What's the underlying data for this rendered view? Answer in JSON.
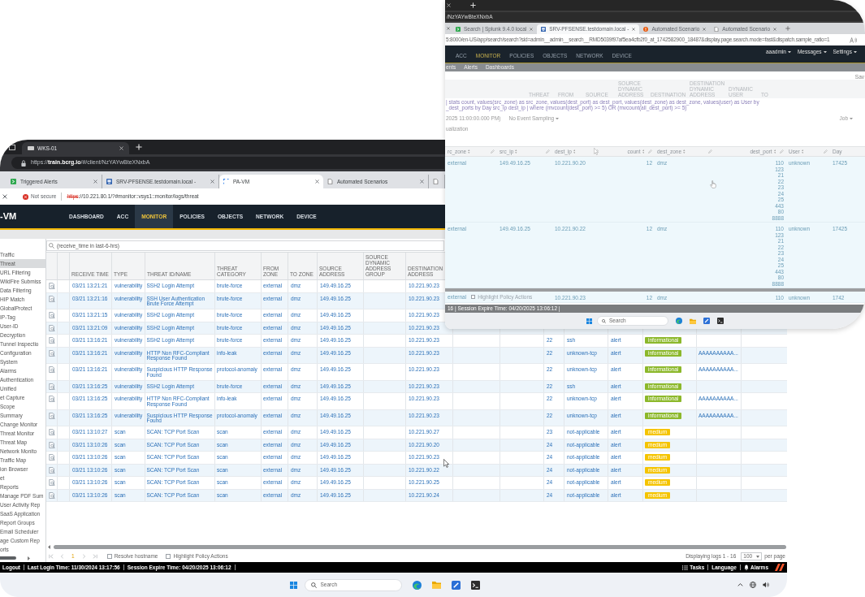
{
  "front_window": {
    "window_tab": {
      "title": "WKS-01"
    },
    "address": "https://**train.bcrg.io**/#/client/NzYAYwBteXNxbA",
    "tabs": [
      {
        "title": "Triggered Alerts",
        "selected": false
      },
      {
        "title": "SRV-PFSENSE.testdomain.local -",
        "selected": false
      },
      {
        "title": "PA-VM",
        "selected": true
      },
      {
        "title": "Automated Scenarios",
        "selected": false
      },
      {
        "selected": false
      }
    ],
    "security": "Not secure",
    "url": {
      "scheme": "https",
      "rest": "://10.221.80.1/?#monitor::vsys1::monitor/logs/threat"
    },
    "logo": "-VM",
    "nav": [
      {
        "label": "DASHBOARD",
        "selected": false
      },
      {
        "label": "ACC",
        "selected": false
      },
      {
        "label": "MONITOR",
        "selected": true
      },
      {
        "label": "POLICIES",
        "selected": false
      },
      {
        "label": "OBJECTS",
        "selected": false
      },
      {
        "label": "NETWORK",
        "selected": false
      },
      {
        "label": "DEVICE",
        "selected": false
      }
    ],
    "sidebar": [
      {
        "label": "Traffic",
        "selected": false
      },
      {
        "label": "Threat",
        "selected": true
      },
      {
        "label": "URL Filtering",
        "selected": false
      },
      {
        "label": "WildFire Submiss",
        "selected": false
      },
      {
        "label": "Data Filtering",
        "selected": false
      },
      {
        "label": "HIP Match",
        "selected": false
      },
      {
        "label": "GlobalProtect",
        "selected": false
      },
      {
        "label": "IP-Tag",
        "selected": false
      },
      {
        "label": "User-ID",
        "selected": false
      },
      {
        "label": "Decryption",
        "selected": false
      },
      {
        "label": "Tunnel Inspectio",
        "selected": false
      },
      {
        "label": "Configuration",
        "selected": false
      },
      {
        "label": "System",
        "selected": false
      },
      {
        "label": "Alarms",
        "selected": false
      },
      {
        "label": "Authentication",
        "selected": false
      },
      {
        "label": "Unified",
        "selected": false
      },
      {
        "label": "et Capture",
        "selected": false
      },
      {
        "label": "Scope",
        "selected": false
      },
      {
        "label": "Summary",
        "selected": false
      },
      {
        "label": "Change Monitor",
        "selected": false
      },
      {
        "label": "Threat Monitor",
        "selected": false
      },
      {
        "label": "Threat Map",
        "selected": false
      },
      {
        "label": "Network Monito",
        "selected": false
      },
      {
        "label": "Traffic Map",
        "selected": false
      },
      {
        "label": "ion Browser",
        "selected": false
      },
      {
        "label": "et",
        "selected": false
      },
      {
        "label": "Reports",
        "selected": false
      },
      {
        "label": "Manage PDF Sum",
        "selected": false
      },
      {
        "label": "User Activity Rep",
        "selected": false
      },
      {
        "label": "SaaS Application",
        "selected": false
      },
      {
        "label": "Report Groups",
        "selected": false
      },
      {
        "label": "Email Scheduler",
        "selected": false
      },
      {
        "label": "age Custom Rep",
        "selected": false
      },
      {
        "label": "orts",
        "selected": false
      }
    ],
    "filter": {
      "value": "(receive_time in last-6-hrs)"
    },
    "table": {
      "columns": [
        "RECEIVE TIME",
        "TYPE",
        "THREAT ID/NAME",
        "THREAT CATEGORY",
        "FROM ZONE",
        "TO ZONE",
        "SOURCE ADDRESS",
        "SOURCE DYNAMIC ADDRESS GROUP",
        "DESTINATION ADDRESS"
      ],
      "rows": [
        {
          "receive_time": "03/21 13:21:21",
          "type": "vulnerability",
          "threat": "SSH2 Login Attempt",
          "category": "brute-force",
          "from_zone": "external",
          "to_zone": "dmz",
          "source": "149.49.16.25",
          "destination": "10.221.90.23"
        },
        {
          "receive_time": "03/21 13:21:16",
          "type": "vulnerability",
          "threat": "SSH User Authentication Brute Force Attempt",
          "category": "brute-force",
          "from_zone": "external",
          "to_zone": "dmz",
          "source": "149.49.16.25",
          "destination": "10.221.90.23"
        },
        {
          "receive_time": "03/21 13:21:15",
          "type": "vulnerability",
          "threat": "SSH2 Login Attempt",
          "category": "brute-force",
          "from_zone": "external",
          "to_zone": "dmz",
          "source": "149.49.16.25",
          "destination": "10.221.90.23"
        },
        {
          "receive_time": "03/21 13:21:09",
          "type": "vulnerability",
          "threat": "SSH2 Login Attempt",
          "category": "brute-force",
          "from_zone": "external",
          "to_zone": "dmz",
          "source": "149.49.16.25",
          "destination": "10.221.90.23"
        },
        {
          "receive_time": "03/21 13:16:21",
          "type": "vulnerability",
          "threat": "SSH2 Login Attempt",
          "category": "brute-force",
          "from_zone": "external",
          "to_zone": "dmz",
          "source": "149.49.16.25",
          "destination": "10.221.90.23",
          "column_14": "22",
          "column_15": "ssh",
          "column_16": "alert",
          "column_17": {
            "label": "informational",
            "color": "#8cb82b"
          }
        },
        {
          "receive_time": "03/21 13:16:21",
          "type": "vulnerability",
          "threat": "HTTP Non RFC-Compliant Response Found",
          "category": "info-leak",
          "from_zone": "external",
          "to_zone": "dmz",
          "source": "149.49.16.25",
          "destination": "10.221.90.23",
          "column_14": "22",
          "column_15": "unknown-tcp",
          "column_16": "alert",
          "column_17": {
            "label": "informational",
            "color": "#8cb82b"
          },
          "column_18": "AAAAAAAAAA..."
        },
        {
          "receive_time": "03/21 13:16:21",
          "type": "vulnerability",
          "threat": "Suspicious HTTP Response Found",
          "category": "protocol-anomaly",
          "from_zone": "external",
          "to_zone": "dmz",
          "source": "149.49.16.25",
          "destination": "10.221.90.23",
          "column_14": "22",
          "column_15": "unknown-tcp",
          "column_16": "alert",
          "column_17": {
            "label": "informational",
            "color": "#8cb82b"
          },
          "column_18": "AAAAAAAAAA..."
        },
        {
          "receive_time": "03/21 13:16:25",
          "type": "vulnerability",
          "threat": "SSH2 Login Attempt",
          "category": "brute-force",
          "from_zone": "external",
          "to_zone": "dmz",
          "source": "149.49.16.25",
          "destination": "10.221.90.23",
          "column_14": "22",
          "column_15": "ssh",
          "column_16": "alert",
          "column_17": {
            "label": "informational",
            "color": "#8cb82b"
          }
        },
        {
          "receive_time": "03/21 13:16:25",
          "type": "vulnerability",
          "threat": "HTTP Non RFC-Compliant Response Found",
          "category": "info-leak",
          "from_zone": "external",
          "to_zone": "dmz",
          "source": "149.49.16.25",
          "destination": "10.221.90.23",
          "column_14": "22",
          "column_15": "unknown-tcp",
          "column_16": "alert",
          "column_17": {
            "label": "informational",
            "color": "#8cb82b"
          },
          "column_18": "AAAAAAAAAA..."
        },
        {
          "receive_time": "03/21 13:16:25",
          "type": "vulnerability",
          "threat": "Suspicious HTTP Response Found",
          "category": "protocol-anomaly",
          "from_zone": "external",
          "to_zone": "dmz",
          "source": "149.49.16.25",
          "destination": "10.221.90.23",
          "column_14": "22",
          "column_15": "unknown-tcp",
          "column_16": "alert",
          "column_17": {
            "label": "informational",
            "color": "#8cb82b"
          },
          "column_18": "AAAAAAAAAA..."
        },
        {
          "receive_time": "03/21 13:10:27",
          "type": "scan",
          "threat": "SCAN: TCP Port Scan",
          "category": "scan",
          "from_zone": "external",
          "to_zone": "dmz",
          "source": "149.49.16.25",
          "destination": "10.221.90.27",
          "column_14": "23",
          "column_15": "not-applicable",
          "column_16": "alert",
          "column_17": {
            "label": "medium",
            "color": "#f5c400"
          }
        },
        {
          "receive_time": "03/21 13:10:26",
          "type": "scan",
          "threat": "SCAN: TCP Port Scan",
          "category": "scan",
          "from_zone": "external",
          "to_zone": "dmz",
          "source": "149.49.16.25",
          "destination": "10.221.90.20",
          "column_14": "24",
          "column_15": "not-applicable",
          "column_16": "alert",
          "column_17": {
            "label": "medium",
            "color": "#f5c400"
          }
        },
        {
          "receive_time": "03/21 13:10:26",
          "type": "scan",
          "threat": "SCAN: TCP Port Scan",
          "category": "scan",
          "from_zone": "external",
          "to_zone": "dmz",
          "source": "149.49.16.25",
          "destination": "10.221.90.23",
          "column_14": "24",
          "column_15": "not-applicable",
          "column_16": "alert",
          "column_17": {
            "label": "medium",
            "color": "#f5c400"
          }
        },
        {
          "receive_time": "03/21 13:10:26",
          "type": "scan",
          "threat": "SCAN: TCP Port Scan",
          "category": "scan",
          "from_zone": "external",
          "to_zone": "dmz",
          "source": "149.49.16.25",
          "destination": "10.221.90.22",
          "column_14": "24",
          "column_15": "not-applicable",
          "column_16": "alert",
          "column_17": {
            "label": "medium",
            "color": "#f5c400"
          }
        },
        {
          "receive_time": "03/21 13:10:26",
          "type": "scan",
          "threat": "SCAN: TCP Port Scan",
          "category": "scan",
          "from_zone": "external",
          "to_zone": "dmz",
          "source": "149.49.16.25",
          "destination": "10.221.90.25",
          "column_14": "24",
          "column_15": "not-applicable",
          "column_16": "alert",
          "column_17": {
            "label": "medium",
            "color": "#f5c400"
          }
        },
        {
          "receive_time": "03/21 13:10:26",
          "type": "scan",
          "threat": "SCAN: TCP Port Scan",
          "category": "scan",
          "from_zone": "external",
          "to_zone": "dmz",
          "source": "149.49.16.25",
          "destination": "10.221.90.24",
          "column_14": "24",
          "column_15": "not-applicable",
          "column_16": "alert",
          "column_17": {
            "label": "medium",
            "color": "#f5c400"
          }
        }
      ]
    },
    "pager": {
      "page": "1",
      "options": [
        {
          "label": "Resolve hostname",
          "checked": false
        },
        {
          "label": "Highlight Policy Actions",
          "checked": false
        }
      ],
      "summary": "Displaying logs 1 - 16",
      "page_size": "100",
      "page_size_label": "per page"
    },
    "footer": {
      "items": [
        "Logout",
        "Last Login Time: 11/30/2024 13:17:56",
        "Session Expire Time: 04/20/2025 13:06:12"
      ],
      "tasks": "Tasks",
      "language": "Language",
      "alarms": "Alarms"
    },
    "taskbar": {
      "placeholder": "Search"
    }
  },
  "back_window": {
    "address": "/NzYAYwBteXNxbA",
    "tabs": [
      {
        "title": "Search | Splunk 9.4.0 local",
        "selected": false
      },
      {
        "title": "SRV-PFSENSE.testdomain.local -",
        "selected": true
      },
      {
        "title": "Automated Scenario",
        "selected": false
      },
      {
        "title": "Automated Scenario",
        "selected": false
      }
    ],
    "url": "5:8000/en-US/app/search/search?sid=admin__admin__search__RMD5039f97af5ea4cfb2f0_at_1742582900_18487&display.page.search.mode=fast&dispatch.sample_ratio=1",
    "nav": [
      {
        "label": "ACC",
        "selected": false
      },
      {
        "label": "MONITOR",
        "selected": true
      },
      {
        "label": "POLICIES",
        "selected": false
      },
      {
        "label": "OBJECTS",
        "selected": false
      },
      {
        "label": "NETWORK",
        "selected": false
      },
      {
        "label": "DEVICE",
        "selected": false
      }
    ],
    "menus": [
      "aaadmin",
      "Messages",
      "Settings"
    ],
    "subnav": [
      "ents",
      "Alerts",
      "Dashboards"
    ],
    "save": "Sav",
    "ghost_headers": [
      "THREAT",
      "FROM",
      "SOURCE",
      "SOURCE DYNAMIC ADDRESS",
      "DESTINATION",
      "DESTINATION DYNAMIC ADDRESS",
      "DYNAMIC USER",
      "TO"
    ],
    "query": [
      "| stats count, values(src_zone) as src_zone, values(dest_port) as dest_port, values(dest_zone) as dest_zone, values(user) as User by",
      "_dest_ports by Day src_ip dest_ip | where (mvcount(dest_port) >= 5) OR (mvcount(all_dest_port) >= 5)"
    ],
    "time_range": "2025 11:00:00.000 PM)",
    "sampling": "No Event Sampling",
    "job": "Job",
    "tab_label": "ualization",
    "table": {
      "columns": [
        "rc_zone",
        "src_ip",
        "dest_ip",
        "count",
        "dest_zone",
        "dest_port",
        "User",
        "Day"
      ],
      "rows": [
        {
          "src_zone": "external",
          "src_ip": "149.49.16.25",
          "dest_ip": "10.221.90.20",
          "count": "12",
          "dest_zone": "dmz",
          "dest_port": [
            "110",
            "123",
            "21",
            "22",
            "23",
            "24",
            "25",
            "443",
            "80",
            "8888"
          ],
          "user": "unknown",
          "day": "17425"
        },
        {
          "src_zone": "external",
          "src_ip": "149.49.16.25",
          "dest_ip": "10.221.90.22",
          "count": "12",
          "dest_zone": "dmz",
          "dest_port": [
            "110",
            "123",
            "21",
            "22",
            "23",
            "24",
            "25",
            "443",
            "80",
            "8888"
          ],
          "user": "unknown",
          "day": "17425"
        },
        {
          "src_zone": "external",
          "overlay": {
            "label": "Highlight Policy Actions",
            "checked": false
          },
          "dest_ip": "10.221.90.23",
          "count": "12",
          "dest_zone": "dmz",
          "dest_port": [
            "110"
          ],
          "user": "unknown",
          "day": "1742"
        }
      ]
    },
    "footer": "16 | Session Expire Time: 04/20/2025 13:06:12 |",
    "taskbar": {
      "placeholder": "Search"
    }
  }
}
